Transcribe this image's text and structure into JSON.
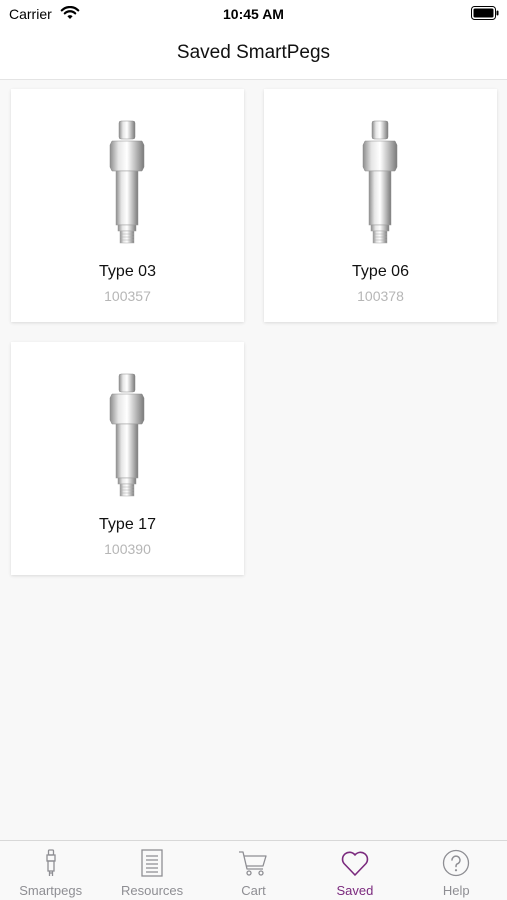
{
  "status_bar": {
    "carrier": "Carrier",
    "time": "10:45 AM"
  },
  "header": {
    "title": "Saved SmartPegs"
  },
  "saved_items": [
    {
      "name": "Type 03",
      "code": "100357"
    },
    {
      "name": "Type 06",
      "code": "100378"
    },
    {
      "name": "Type 17",
      "code": "100390"
    }
  ],
  "tab_bar": {
    "items": [
      {
        "label": "Smartpegs",
        "icon": "smartpeg-icon"
      },
      {
        "label": "Resources",
        "icon": "document-icon"
      },
      {
        "label": "Cart",
        "icon": "cart-icon"
      },
      {
        "label": "Saved",
        "icon": "heart-icon"
      },
      {
        "label": "Help",
        "icon": "help-icon"
      }
    ],
    "active": "Saved"
  },
  "colors": {
    "accent": "#7b2a7e",
    "inactive": "#8e8e93",
    "code_text": "#b6b6b6",
    "background": "#f8f8f8"
  }
}
